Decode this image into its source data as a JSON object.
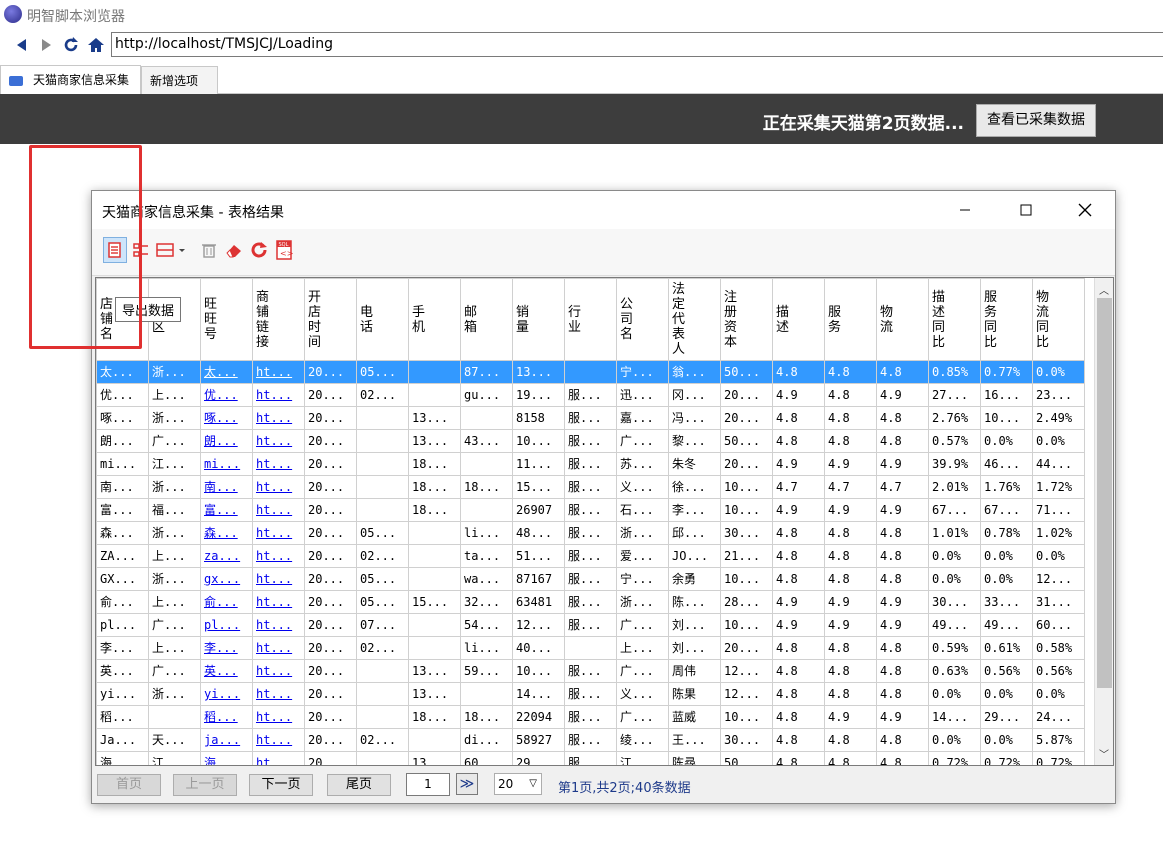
{
  "app": {
    "title": "明智脚本浏览器"
  },
  "nav": {
    "url": "http://localhost/TMSJCJ/Loading",
    "back_icon": "back-arrow-icon",
    "forward_icon": "forward-arrow-icon",
    "refresh_icon": "refresh-icon",
    "home_icon": "home-icon"
  },
  "tabs": [
    {
      "label": "天猫商家信息采集"
    },
    {
      "label": "新增选项卡"
    }
  ],
  "banner": {
    "message": "正在采集天猫第2页数据...",
    "view_button": "查看已采集数据"
  },
  "dialog": {
    "title": "天猫商家信息采集 - 表格结果",
    "tooltip": "导出数据",
    "tools": [
      "export-data-icon",
      "list-icon",
      "columns-icon",
      "delete-icon",
      "eraser-icon",
      "refresh-icon",
      "sql-icon"
    ]
  },
  "table": {
    "headers": [
      "店铺名",
      "地区",
      "旺旺号",
      "商铺链接",
      "开店时间",
      "电话",
      "手机",
      "邮箱",
      "销量",
      "行业",
      "公司名",
      "法定代表人",
      "注册资本",
      "描述",
      "服务",
      "物流",
      "描述同比",
      "服务同比",
      "物流同比"
    ],
    "rows": [
      [
        "太...",
        "浙...",
        "太...",
        "ht...",
        "20...",
        "05...",
        "",
        "87...",
        "13...",
        "",
        "宁...",
        "翁...",
        "50...",
        "4.8",
        "4.8",
        "4.8",
        "0.85%",
        "0.77%",
        "0.0%"
      ],
      [
        "优...",
        "上...",
        "优...",
        "ht...",
        "20...",
        "02...",
        "",
        "gu...",
        "19...",
        "服...",
        "迅...",
        "冈...",
        "20...",
        "4.9",
        "4.8",
        "4.9",
        "27...",
        "16...",
        "23..."
      ],
      [
        "啄...",
        "浙...",
        "啄...",
        "ht...",
        "20...",
        "",
        "13...",
        "",
        "8158",
        "服...",
        "嘉...",
        "冯...",
        "20...",
        "4.8",
        "4.8",
        "4.8",
        "2.76%",
        "10...",
        "2.49%"
      ],
      [
        "朗...",
        "广...",
        "朗...",
        "ht...",
        "20...",
        "",
        "13...",
        "43...",
        "10...",
        "服...",
        "广...",
        "黎...",
        "50...",
        "4.8",
        "4.8",
        "4.8",
        "0.57%",
        "0.0%",
        "0.0%"
      ],
      [
        "mi...",
        "江...",
        "mi...",
        "ht...",
        "20...",
        "",
        "18...",
        "",
        "11...",
        "服...",
        "苏...",
        "朱冬",
        "20...",
        "4.9",
        "4.9",
        "4.9",
        "39.9%",
        "46...",
        "44..."
      ],
      [
        "南...",
        "浙...",
        "南...",
        "ht...",
        "20...",
        "",
        "18...",
        "18...",
        "15...",
        "服...",
        "义...",
        "徐...",
        "10...",
        "4.7",
        "4.7",
        "4.7",
        "2.01%",
        "1.76%",
        "1.72%"
      ],
      [
        "富...",
        "福...",
        "富...",
        "ht...",
        "20...",
        "",
        "18...",
        "",
        "26907",
        "服...",
        "石...",
        "李...",
        "10...",
        "4.9",
        "4.9",
        "4.9",
        "67...",
        "67...",
        "71..."
      ],
      [
        "森...",
        "浙...",
        "森...",
        "ht...",
        "20...",
        "05...",
        "",
        "li...",
        "48...",
        "服...",
        "浙...",
        "邱...",
        "30...",
        "4.8",
        "4.8",
        "4.8",
        "1.01%",
        "0.78%",
        "1.02%"
      ],
      [
        "ZA...",
        "上...",
        "za...",
        "ht...",
        "20...",
        "02...",
        "",
        "ta...",
        "51...",
        "服...",
        "爱...",
        "JO...",
        "21...",
        "4.8",
        "4.8",
        "4.8",
        "0.0%",
        "0.0%",
        "0.0%"
      ],
      [
        "GX...",
        "浙...",
        "gx...",
        "ht...",
        "20...",
        "05...",
        "",
        "wa...",
        "87167",
        "服...",
        "宁...",
        "余勇",
        "10...",
        "4.8",
        "4.8",
        "4.8",
        "0.0%",
        "0.0%",
        "12..."
      ],
      [
        "俞...",
        "上...",
        "俞...",
        "ht...",
        "20...",
        "05...",
        "15...",
        "32...",
        "63481",
        "服...",
        "浙...",
        "陈...",
        "28...",
        "4.9",
        "4.9",
        "4.9",
        "30...",
        "33...",
        "31..."
      ],
      [
        "pl...",
        "广...",
        "pl...",
        "ht...",
        "20...",
        "07...",
        "",
        "54...",
        "12...",
        "服...",
        "广...",
        "刘...",
        "10...",
        "4.9",
        "4.9",
        "4.9",
        "49...",
        "49...",
        "60..."
      ],
      [
        "李...",
        "上...",
        "李...",
        "ht...",
        "20...",
        "02...",
        "",
        "li...",
        "40...",
        "",
        "上...",
        "刘...",
        "20...",
        "4.8",
        "4.8",
        "4.8",
        "0.59%",
        "0.61%",
        "0.58%"
      ],
      [
        "英...",
        "广...",
        "英...",
        "ht...",
        "20...",
        "",
        "13...",
        "59...",
        "10...",
        "服...",
        "广...",
        "周伟",
        "12...",
        "4.8",
        "4.8",
        "4.8",
        "0.63%",
        "0.56%",
        "0.56%"
      ],
      [
        "yi...",
        "浙...",
        "yi...",
        "ht...",
        "20...",
        "",
        "13...",
        "",
        "14...",
        "服...",
        "义...",
        "陈果",
        "12...",
        "4.8",
        "4.8",
        "4.8",
        "0.0%",
        "0.0%",
        "0.0%"
      ],
      [
        "稻...",
        "",
        "稻...",
        "ht...",
        "20...",
        "",
        "18...",
        "18...",
        "22094",
        "服...",
        "广...",
        "蓝威",
        "10...",
        "4.8",
        "4.9",
        "4.9",
        "14...",
        "29...",
        "24..."
      ],
      [
        "Ja...",
        "天...",
        "ja...",
        "ht...",
        "20...",
        "02...",
        "",
        "di...",
        "58927",
        "服...",
        "绫...",
        "王...",
        "30...",
        "4.8",
        "4.8",
        "4.8",
        "0.0%",
        "0.0%",
        "5.87%"
      ],
      [
        "海...",
        "江...",
        "海...",
        "ht...",
        "20...",
        "",
        "13...",
        "60...",
        "29...",
        "服...",
        "江...",
        "陈尋",
        "50...",
        "4.8",
        "4.8",
        "4.8",
        "0.72%",
        "0.72%",
        "0.72%"
      ]
    ]
  },
  "pager": {
    "first": "首页",
    "prev": "上一页",
    "next": "下一页",
    "last": "尾页",
    "page": "1",
    "go": "≫",
    "size": "20",
    "info": "第1页,共2页;40条数据"
  }
}
